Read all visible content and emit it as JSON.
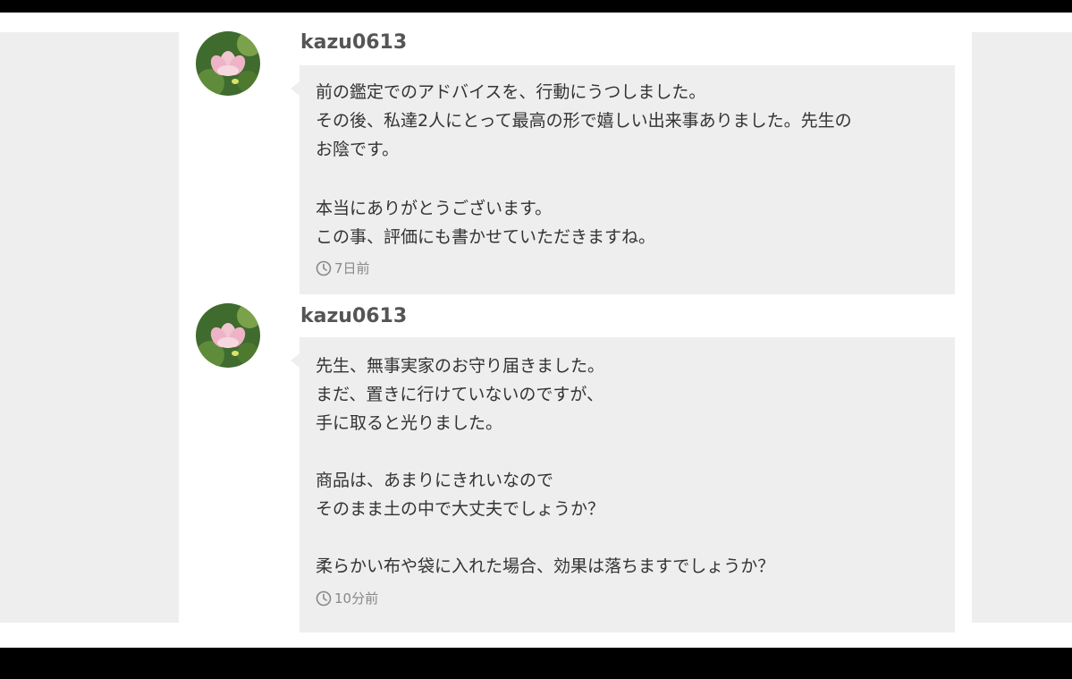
{
  "comments": [
    {
      "username": "kazu0613",
      "lines": [
        "前の鑑定でのアドバイスを、行動にうつしました。",
        "その後、私達2人にとって最高の形で嬉しい出来事ありました。先生の",
        "お陰です。",
        "",
        "本当にありがとうございます。",
        "この事、評価にも書かせていただきますね。"
      ],
      "time": "7日前",
      "time_icon": "clock-icon"
    },
    {
      "username": "kazu0613",
      "lines": [
        "先生、無事実家のお守り届きました。",
        "まだ、置きに行けていないのですが、",
        "手に取ると光りました。",
        "",
        "商品は、あまりにきれいなので",
        "そのまま土の中で大丈夫でしょうか？",
        "",
        "柔らかい布や袋に入れた場合、効果は落ちますでしょうか？"
      ],
      "time": "10分前",
      "time_icon": "clock-icon"
    }
  ],
  "colors": {
    "bubble_bg": "#eeeeee",
    "side_panel_bg": "#eeeeee",
    "username": "#555555",
    "body_text": "#333333",
    "meta_text": "#888888"
  }
}
